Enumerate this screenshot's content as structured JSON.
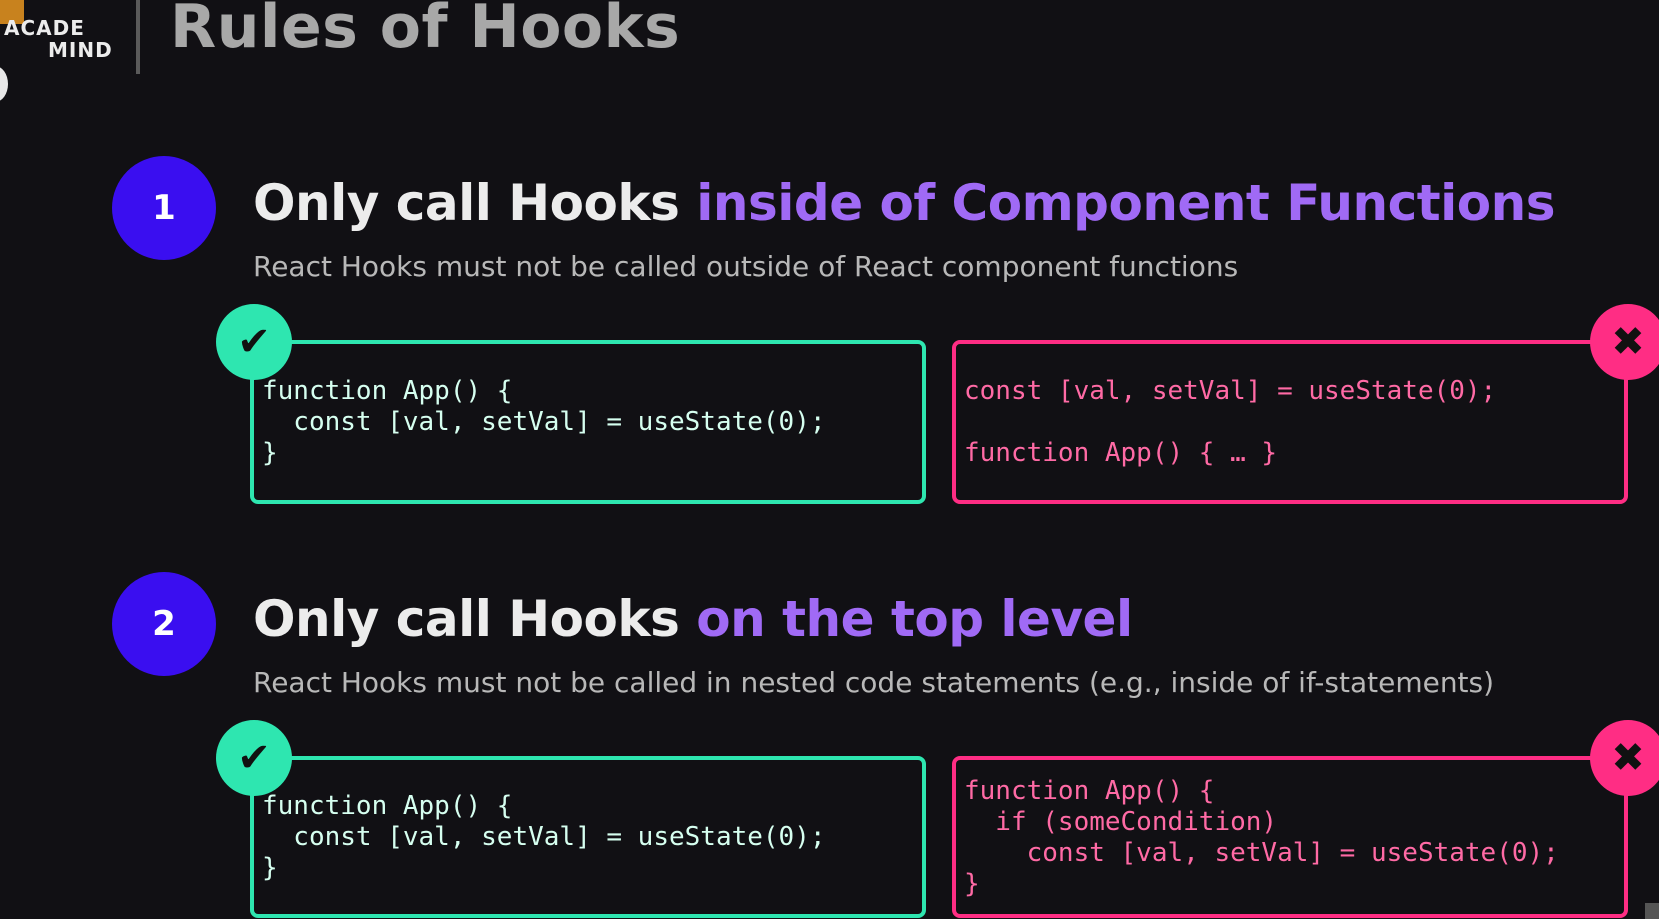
{
  "logo": {
    "line1": "ACADE",
    "line2": "MIND"
  },
  "title": "Rules of Hooks",
  "rules": [
    {
      "number": "1",
      "heading_plain": "Only call Hooks ",
      "heading_accent": "inside of Component Functions",
      "subtitle": "React Hooks must not be called outside of React component functions",
      "good_code": "function App() {\n  const [val, setVal] = useState(0);\n}",
      "bad_code": "const [val, setVal] = useState(0);\n\nfunction App() { … }"
    },
    {
      "number": "2",
      "heading_plain": "Only call Hooks ",
      "heading_accent": "on the top level",
      "subtitle": "React Hooks must not be called in nested code statements (e.g., inside of if-statements)",
      "good_code": "function App() {\n  const [val, setVal] = useState(0);\n}",
      "bad_code": "function App() {\n  if (someCondition)\n    const [val, setVal] = useState(0);\n}"
    }
  ],
  "icons": {
    "good": "check-icon",
    "bad": "cross-icon"
  },
  "colors": {
    "accent": "#a06af5",
    "number_circle": "#3a0ef0",
    "good": "#2ee6b0",
    "bad": "#ff2d84",
    "background": "#111014"
  },
  "glyphs": {
    "check": "✔",
    "cross": "✖"
  }
}
